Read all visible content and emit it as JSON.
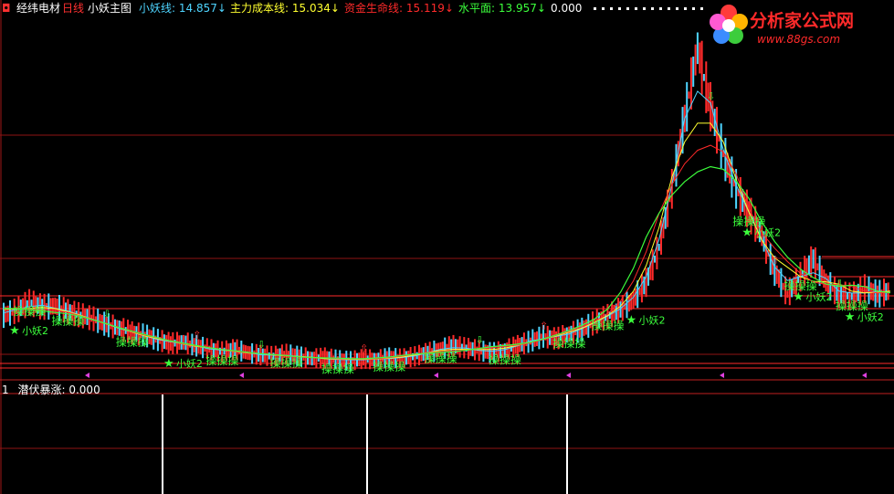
{
  "header": {
    "stock_name": "经纬电材",
    "period": "日线",
    "indicator_name": "小妖主图",
    "items": [
      {
        "label": "小妖线:",
        "value": "14.857",
        "arrow": "↓",
        "color": "#4ed4ff"
      },
      {
        "label": "主力成本线:",
        "value": "15.034",
        "arrow": "↓",
        "color": "#ffff30"
      },
      {
        "label": "资金生命线:",
        "value": "15.119",
        "arrow": "↓",
        "color": "#ff2a2a"
      },
      {
        "label": "水平面:",
        "value": "13.957",
        "arrow": "↓",
        "color": "#3cff3c"
      },
      {
        "label": "",
        "value": "0.000",
        "arrow": "",
        "color": "#ffffff"
      }
    ]
  },
  "logo": {
    "title": "分析家公式网",
    "url": "www.88gs.com"
  },
  "subpanel": {
    "index": "1",
    "label": "潜伏暴涨:",
    "value": "0.000"
  },
  "chart_data": {
    "type": "line",
    "title": "",
    "series_colors": {
      "price": "#ff2a2a",
      "xiaoyao": "#4ed4ff",
      "cost": "#ffff30",
      "life": "#ff2a2a",
      "water": "#3cff3c"
    },
    "price_series": [
      13.2,
      13.6,
      14.3,
      13.9,
      14.0,
      13.5,
      13.2,
      12.9,
      12.4,
      12.1,
      11.7,
      11.5,
      11.1,
      10.8,
      10.9,
      10.6,
      10.3,
      10.1,
      10.3,
      10.0,
      9.8,
      9.7,
      9.9,
      9.7,
      9.5,
      9.6,
      9.4,
      9.3,
      9.5,
      9.4,
      9.6,
      9.5,
      9.7,
      10.0,
      10.3,
      10.6,
      10.4,
      10.2,
      10.0,
      10.2,
      10.6,
      11.0,
      11.4,
      11.2,
      11.6,
      12.0,
      12.6,
      13.1,
      13.7,
      14.5,
      16.0,
      19.0,
      24.0,
      30.0,
      36.0,
      31.0,
      27.0,
      24.0,
      22.0,
      20.0,
      17.0,
      15.0,
      16.5,
      18.0,
      16.0,
      15.0,
      14.8,
      15.5,
      15.0,
      15.3
    ],
    "zhangting_labels": [
      "小妖2",
      "小妖2",
      "小妖2",
      "小妖2",
      "小妖2",
      "小妖2"
    ],
    "signal_text": "操",
    "sub_signal_positions": [
      178,
      402,
      621
    ],
    "logo_colors": [
      "#ff3b3b",
      "#ffb400",
      "#3ccd3c",
      "#3b8cff",
      "#ff5ad2"
    ]
  }
}
